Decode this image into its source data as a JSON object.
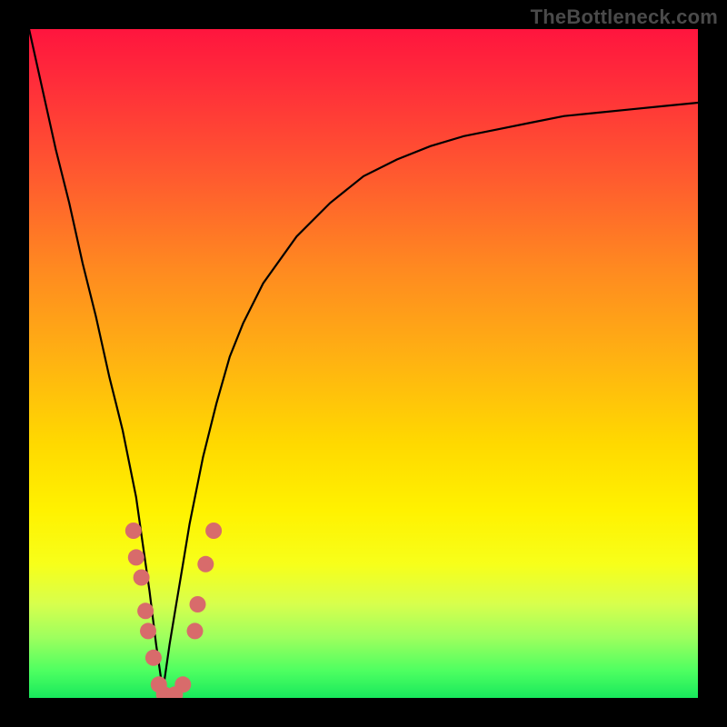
{
  "watermark": "TheBottleneck.com",
  "chart_data": {
    "type": "line",
    "title": "",
    "xlabel": "",
    "ylabel": "",
    "xlim": [
      0,
      100
    ],
    "ylim": [
      0,
      100
    ],
    "grid": false,
    "legend": false,
    "series": [
      {
        "name": "curve",
        "color": "#000000",
        "x": [
          0,
          2,
          4,
          6,
          8,
          10,
          12,
          13,
          14,
          15,
          16,
          17,
          18,
          19,
          20,
          21,
          22,
          23,
          24,
          25,
          26,
          28,
          30,
          32,
          35,
          40,
          45,
          50,
          55,
          60,
          65,
          70,
          75,
          80,
          85,
          90,
          95,
          100
        ],
        "y": [
          100,
          91,
          82,
          74,
          65,
          57,
          48,
          44,
          40,
          35,
          30,
          23,
          16,
          8,
          1,
          8,
          14,
          20,
          26,
          31,
          36,
          44,
          51,
          56,
          62,
          69,
          74,
          78,
          80.5,
          82.5,
          84,
          85,
          86,
          87,
          87.5,
          88,
          88.5,
          89
        ]
      }
    ],
    "markers": [
      {
        "name": "dots",
        "color": "#d86b6b",
        "points": [
          {
            "x": 15.6,
            "y": 25
          },
          {
            "x": 16.0,
            "y": 21
          },
          {
            "x": 16.8,
            "y": 18
          },
          {
            "x": 17.4,
            "y": 13
          },
          {
            "x": 17.8,
            "y": 10
          },
          {
            "x": 18.6,
            "y": 6
          },
          {
            "x": 19.4,
            "y": 2
          },
          {
            "x": 20.2,
            "y": 0.5
          },
          {
            "x": 21.8,
            "y": 0.5
          },
          {
            "x": 23.0,
            "y": 2
          },
          {
            "x": 24.8,
            "y": 10
          },
          {
            "x": 25.2,
            "y": 14
          },
          {
            "x": 26.4,
            "y": 20
          },
          {
            "x": 27.6,
            "y": 25
          }
        ]
      }
    ]
  }
}
